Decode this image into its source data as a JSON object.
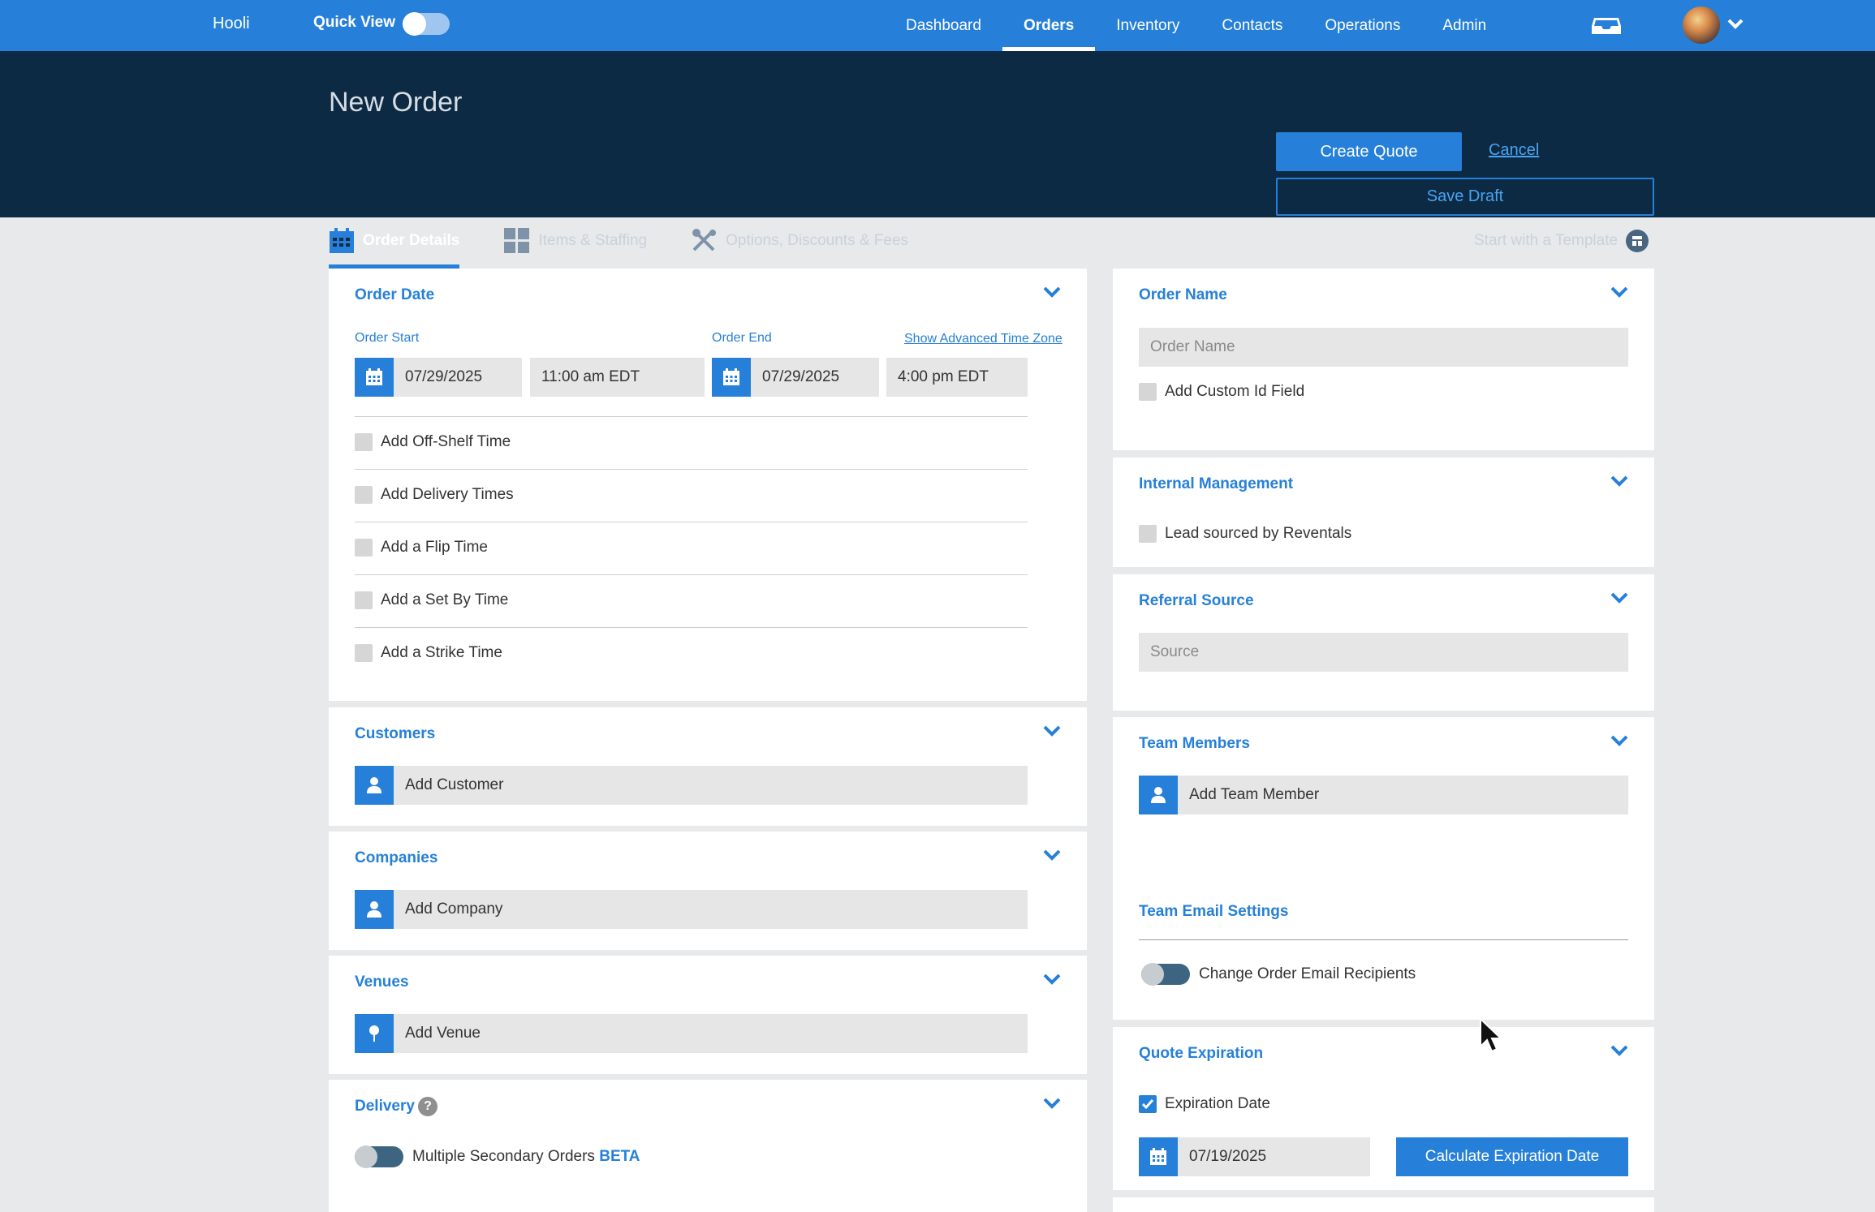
{
  "nav": {
    "brand": "Hooli",
    "quick_view_label": "Quick View",
    "links": [
      {
        "label": "Dashboard",
        "active": false
      },
      {
        "label": "Orders",
        "active": true
      },
      {
        "label": "Inventory",
        "active": false
      },
      {
        "label": "Contacts",
        "active": false
      },
      {
        "label": "Operations",
        "active": false
      },
      {
        "label": "Admin",
        "active": false
      }
    ]
  },
  "header": {
    "title": "New Order",
    "create_quote": "Create Quote",
    "cancel": "Cancel",
    "save_draft": "Save Draft",
    "tabs": [
      {
        "label": "Order Details",
        "icon": "calendar-icon",
        "active": true
      },
      {
        "label": "Items & Staffing",
        "icon": "grid-icon",
        "active": false
      },
      {
        "label": "Options, Discounts & Fees",
        "icon": "tools-icon",
        "active": false
      }
    ],
    "template_link": "Start with a Template"
  },
  "order_date": {
    "title": "Order Date",
    "start_label": "Order Start",
    "end_label": "Order End",
    "advanced_tz": "Show Advanced Time Zone",
    "start_date": "07/29/2025",
    "start_time": "11:00 am EDT",
    "end_date": "07/29/2025",
    "end_time": "4:00 pm EDT",
    "options": [
      "Add Off-Shelf Time",
      "Add Delivery Times",
      "Add a Flip Time",
      "Add a Set By Time",
      "Add a Strike Time"
    ]
  },
  "customers": {
    "title": "Customers",
    "add": "Add Customer"
  },
  "companies": {
    "title": "Companies",
    "add": "Add Company"
  },
  "venues": {
    "title": "Venues",
    "add": "Add Venue"
  },
  "delivery": {
    "title": "Delivery",
    "help": "?",
    "toggle_label": "Multiple Secondary Orders",
    "beta": "BETA"
  },
  "order_name": {
    "title": "Order Name",
    "placeholder": "Order Name",
    "custom_id": "Add Custom Id Field"
  },
  "internal": {
    "title": "Internal Management",
    "lead": "Lead sourced by Reventals"
  },
  "referral": {
    "title": "Referral Source",
    "placeholder": "Source"
  },
  "team": {
    "title": "Team Members",
    "add": "Add Team Member",
    "email_settings": "Team Email Settings",
    "change_recipients": "Change Order Email Recipients"
  },
  "quote_exp": {
    "title": "Quote Expiration",
    "checkbox": "Expiration Date",
    "date": "07/19/2025",
    "calc": "Calculate Expiration Date"
  },
  "colors": {
    "primary": "#2680d9",
    "header_bg": "#0d2a44",
    "page_bg": "#e8e9ea"
  }
}
